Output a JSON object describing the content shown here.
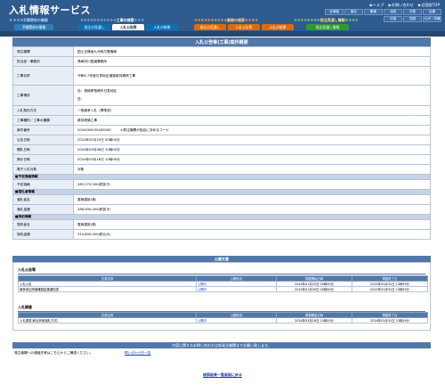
{
  "header": {
    "logo": "入札情報サービス",
    "top_links": [
      "▶ヘルプ",
      "▶お問い合わせ",
      "▶全国版TOP"
    ],
    "regions": [
      "北海道",
      "東北",
      "関東",
      "北陸",
      "中部",
      "近畿",
      "中国",
      "四国",
      "九州・沖縄"
    ],
    "categories": [
      {
        "dots": "＊ ＊＊＊",
        "label": "予算関係の情報"
      },
      {
        "dots": "＊＊＊＊＊＊＊＊＊＊＊",
        "label": "工事の検索",
        "dots2": "＊＊＊"
      },
      {
        "dots": "＊＊＊＊＊＊＊＊＊＊",
        "label": "業務の検索",
        "dots2": "＊＊＊＊"
      },
      {
        "dots": "＊＊＊＊＊＊＊＊",
        "label": "発注見通し情報",
        "dots2": "＊＊＊＊"
      }
    ],
    "tabs": [
      "予算関係の情報",
      "発注の見通し",
      "入札公告等",
      "入札の結果",
      "発注の見通し",
      "入札公告等",
      "入札の結果",
      "発注見通し情報"
    ]
  },
  "panel_title": "入札公告等(工事)案件概要",
  "fields": {
    "orderer": {
      "label": "発注機関",
      "value": "国土交通省九州地方整備局"
    },
    "office": {
      "label": "担当部・事務所",
      "value": "長崎河川国道事務所"
    },
    "name": {
      "label": "工事名称",
      "value": "令和6-7年度日見地区道路維持補修工事"
    },
    "location": {
      "label": "工事場所",
      "value": "自：長崎県長崎市日見地区",
      "value2": "至："
    },
    "method": {
      "label": "入札契約方式",
      "value": "一般競争入札（標準型）"
    },
    "type": {
      "label": "工事種別／工事の種類",
      "value": "維持修繕工事"
    },
    "number": {
      "label": "案件番号",
      "value": "2024009155400000",
      "note": "＊発注機関が独自に決めるコード"
    },
    "announce": {
      "label": "公告日時",
      "value": "2024年01月25日 00時00分"
    },
    "open": {
      "label": "開札日時",
      "value": "2024年03月06日 10時00分"
    },
    "result_date": {
      "label": "掲示日時",
      "value": "2024年03月18日 10時00分"
    },
    "e_bid": {
      "label": "電子入札対象",
      "value": "対象"
    },
    "section_price": {
      "label": "■予定価格情報"
    },
    "planned": {
      "label": "予定価格",
      "value": "285,270,000(税抜き)"
    },
    "section_winner": {
      "label": "■落札者情報"
    },
    "winner": {
      "label": "落札者名",
      "value": "富岡建設(株)"
    },
    "win_amount": {
      "label": "落札金額",
      "value": "286,000,000(税抜き)"
    },
    "section_contract": {
      "label": "■契約情報"
    },
    "contractor": {
      "label": "契約者名",
      "value": "富岡建設(株)"
    },
    "contract_amount": {
      "label": "契約金額",
      "value": "314,600,000(税込み)"
    }
  },
  "docs": {
    "title": "公開文書",
    "bid_docs": {
      "heading": "入札公告等",
      "headers": [
        "文書名称",
        "公開状況",
        "掲載開始日時",
        "掲載終了日"
      ],
      "rows": [
        {
          "name": "入札公告",
          "status": "公開中",
          "start": "2024年01月25日 00時00分",
          "end": "2025年03月31日 23時59分"
        },
        {
          "name": "競争参加資格確認結果通知書",
          "status": "公開中",
          "start": "2024年01月30日 00時00分",
          "end": "2025年03月31日 23時59分"
        }
      ]
    },
    "result_docs": {
      "heading": "入札調書",
      "headers": [
        "文書名称",
        "公開状況",
        "掲載開始日時",
        "掲載終了日"
      ],
      "rows": [
        {
          "name": "入札調書(総合評価落札方式)",
          "status": "公開中",
          "start": "2024年03月18日 10時00分",
          "end": "2026年03月31日 23時59分"
        }
      ]
    }
  },
  "inquiry": {
    "title": "内容に関するお問い合わせは各発注機関までお願い致します。",
    "text": "発注機関への連絡先等はこちらからご確認ください。",
    "link": "問い合わせ先一覧"
  },
  "back_link": "検索結果一覧画面に戻る",
  "colors": {
    "header_bg": "#2f5a8e",
    "panel_title_bg": "#5278a8",
    "budget_tab": "#2e7fb8",
    "works_cat": "#0b6fb5",
    "service_cat": "#e06a00",
    "forecast_cat": "#2e9a2e",
    "link": "#1a44b8"
  }
}
